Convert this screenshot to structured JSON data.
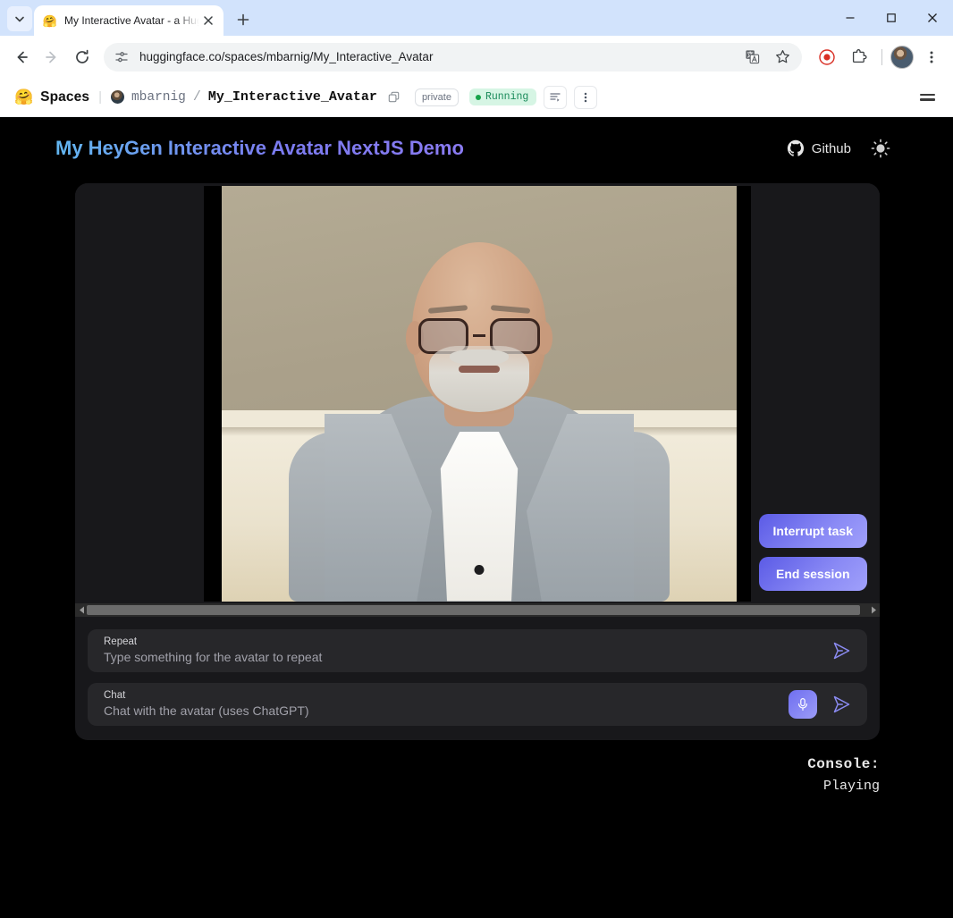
{
  "browser": {
    "tab": {
      "title": "My Interactive Avatar - a Huggi",
      "favicon": "huggingface-emoji-icon",
      "close_label": "×"
    },
    "tab_list_icon": "chevron-down-icon",
    "new_tab_label": "+",
    "window_controls": {
      "minimize": "–",
      "maximize": "□",
      "close": "×"
    },
    "nav": {
      "back_icon": "back-arrow-icon",
      "forward_icon": "forward-arrow-icon",
      "reload_icon": "reload-icon"
    },
    "omnibox": {
      "site_info_icon": "site-settings-icon",
      "url": "huggingface.co/spaces/mbarnig/My_Interactive_Avatar",
      "translate_icon": "translate-icon",
      "bookmark_icon": "star-icon"
    },
    "toolbar_right": {
      "record_icon": "record-indicator-icon",
      "extensions_icon": "extensions-puzzle-icon",
      "profile_icon": "profile-avatar-icon",
      "menu_icon": "three-dots-vertical-icon"
    }
  },
  "hf_header": {
    "logo_icon": "huggingface-emoji-icon",
    "section": "Spaces",
    "separator": "|",
    "owner": "mbarnig",
    "slash": "/",
    "space_name": "My_Interactive_Avatar",
    "copy_icon": "copy-icon",
    "visibility_badge": "private",
    "status_badge": "Running",
    "logs_icon": "logs-icon",
    "more_icon": "three-dots-vertical-icon",
    "menu_icon": "hamburger-menu-icon"
  },
  "app": {
    "title": "My HeyGen Interactive Avatar NextJS Demo",
    "github": {
      "icon": "github-icon",
      "label": "Github"
    },
    "theme_toggle_icon": "sun-icon",
    "video": {
      "alt": "avatar-video-stream",
      "scrollbar": {
        "left_icon": "scroll-left-arrow-icon",
        "right_icon": "scroll-right-arrow-icon"
      }
    },
    "buttons": {
      "interrupt": "Interrupt task",
      "end_session": "End session"
    },
    "fields": [
      {
        "name": "repeat",
        "label": "Repeat",
        "placeholder": "Type something for the avatar to repeat",
        "has_mic": false,
        "send_icon": "send-paper-plane-icon"
      },
      {
        "name": "chat",
        "label": "Chat",
        "placeholder": "Chat with the avatar (uses ChatGPT)",
        "has_mic": true,
        "mic_icon": "microphone-icon",
        "send_icon": "send-paper-plane-icon"
      }
    ],
    "console": {
      "label": "Console:",
      "value": "Playing"
    }
  },
  "colors": {
    "accent_gradient_start": "#5b5be6",
    "accent_gradient_end": "#a0a0fb",
    "title_gradient_start": "#62b6f0",
    "title_gradient_end": "#8a7bf2",
    "status_green": "#16a34a",
    "app_background": "#000000",
    "card_background": "#18181b",
    "field_background": "#27272a"
  }
}
